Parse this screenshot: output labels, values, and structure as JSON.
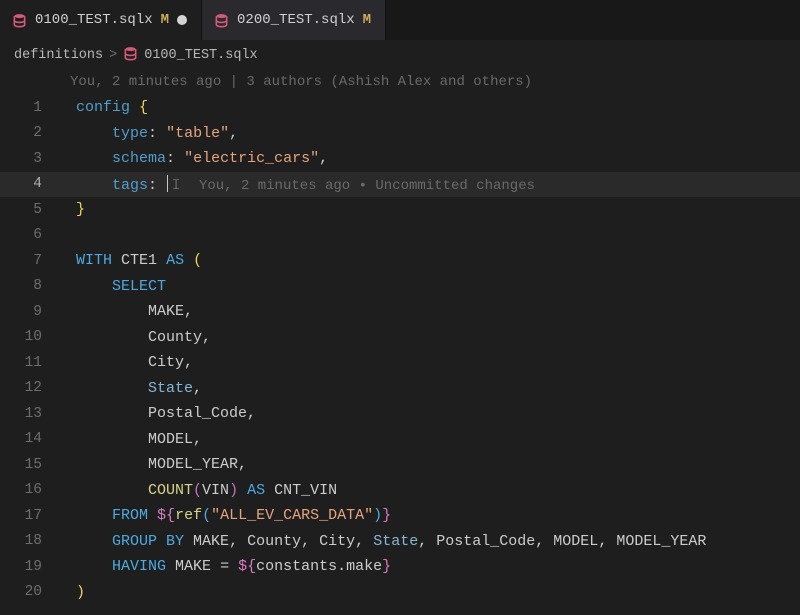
{
  "tabs": [
    {
      "name": "0100_TEST.sqlx",
      "status": "M",
      "dirty": true,
      "active": true
    },
    {
      "name": "0200_TEST.sqlx",
      "status": "M",
      "dirty": false,
      "active": false
    }
  ],
  "breadcrumb": {
    "folder": "definitions",
    "file": "0100_TEST.sqlx",
    "chevron": ">"
  },
  "blame_header": "You, 2 minutes ago | 3 authors (Ashish Alex and others)",
  "inline_blame": "You, 2 minutes ago • Uncommitted changes",
  "code": {
    "config_kw": "config",
    "type_key": "type",
    "type_val": "\"table\"",
    "schema_key": "schema",
    "schema_val": "\"electric_cars\"",
    "tags_key": "tags",
    "with": "WITH",
    "cte_name": "CTE1",
    "as": "AS",
    "select": "SELECT",
    "cols": {
      "make": "MAKE",
      "county": "County",
      "city": "City",
      "state": "State",
      "postal": "Postal_Code",
      "model": "MODEL",
      "model_year": "MODEL_YEAR"
    },
    "count": "COUNT",
    "count_arg": "VIN",
    "count_alias": "CNT_VIN",
    "from": "FROM",
    "ref": "ref",
    "ref_arg": "\"ALL_EV_CARS_DATA\"",
    "group_by": "GROUP BY",
    "having": "HAVING",
    "having_col": "MAKE",
    "constants": "constants",
    "make_prop": "make",
    "brace_open": "{",
    "brace_close": "}",
    "paren_open": "(",
    "paren_close": ")",
    "dollar_open": "${",
    "dollar_close": "}",
    "eq": "=",
    "comma": ",",
    "colon": ":"
  },
  "lines": [
    "1",
    "2",
    "3",
    "4",
    "5",
    "6",
    "7",
    "8",
    "9",
    "10",
    "11",
    "12",
    "13",
    "14",
    "15",
    "16",
    "17",
    "18",
    "19",
    "20"
  ]
}
